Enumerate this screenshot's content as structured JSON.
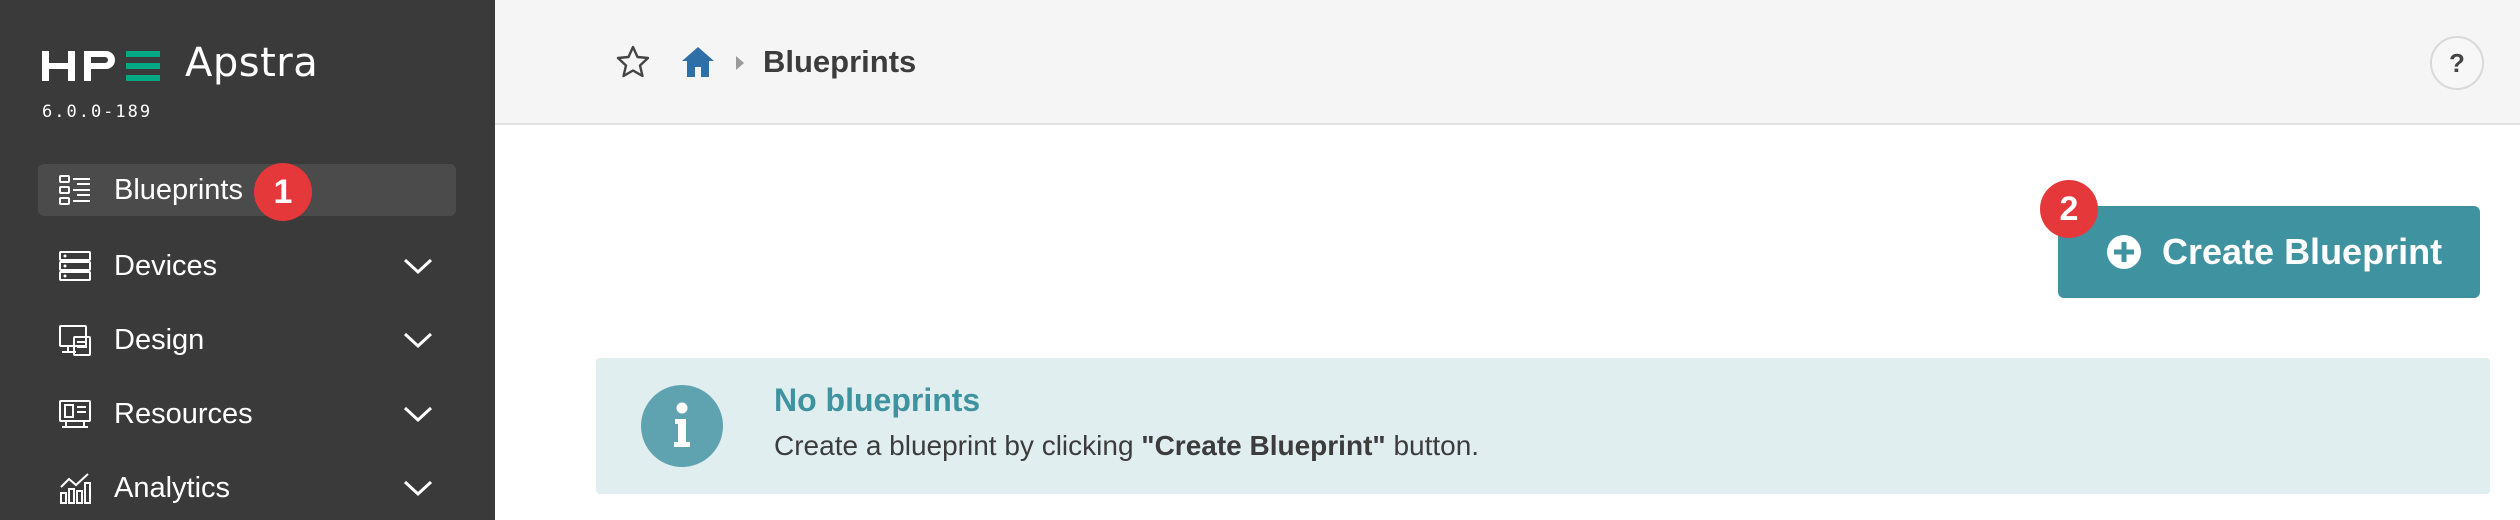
{
  "app": {
    "brand_logo": "HPE",
    "product_name": "Apstra",
    "version": "6.0.0-189"
  },
  "sidebar": {
    "items": [
      {
        "label": "Blueprints",
        "icon": "blueprints-icon",
        "active": true,
        "badge": "1"
      },
      {
        "label": "Devices",
        "icon": "devices-icon"
      },
      {
        "label": "Design",
        "icon": "design-icon"
      },
      {
        "label": "Resources",
        "icon": "resources-icon"
      },
      {
        "label": "Analytics",
        "icon": "analytics-icon"
      }
    ]
  },
  "header": {
    "breadcrumb_title": "Blueprints",
    "help_label": "?"
  },
  "main": {
    "create_button_label": "Create Blueprint",
    "create_badge": "2",
    "empty_state": {
      "title": "No blueprints",
      "text_before": "Create a blueprint by clicking ",
      "text_bold": "\"Create Blueprint\"",
      "text_after": " button."
    }
  },
  "colors": {
    "sidebar_bg": "#3a3a3a",
    "accent_teal": "#3f929f",
    "hpe_green": "#01a982",
    "badge_red": "#e5383b",
    "home_blue": "#2f6fa8"
  }
}
